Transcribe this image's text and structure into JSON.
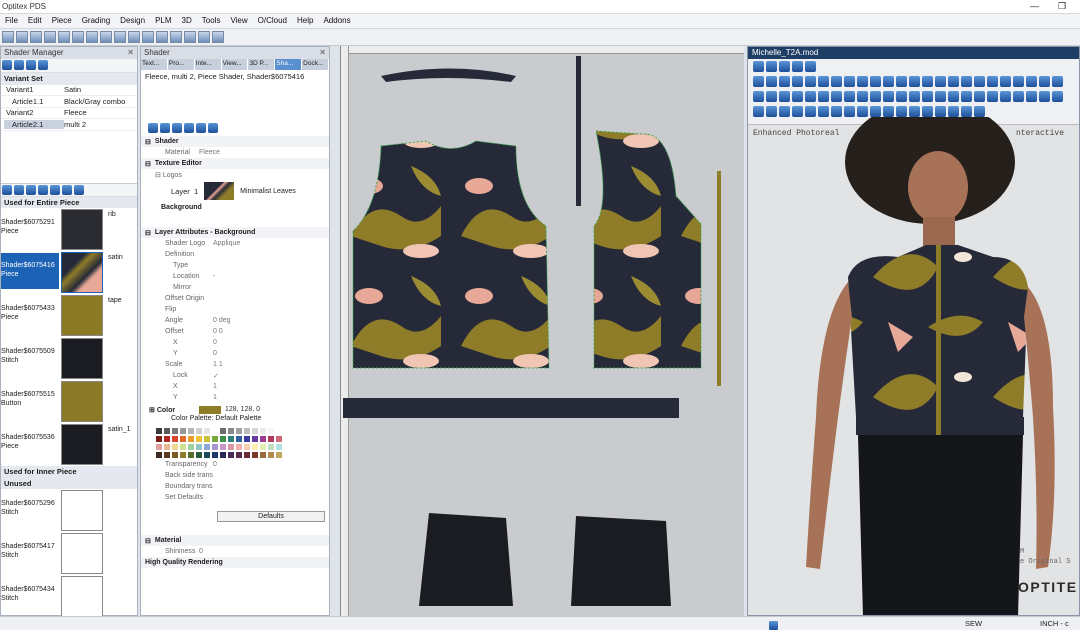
{
  "app": {
    "title": "Optitex PDS",
    "menus": [
      "File",
      "Edit",
      "Piece",
      "Grading",
      "Design",
      "PLM",
      "3D",
      "Tools",
      "View",
      "O/Cloud",
      "Help",
      "Addons"
    ]
  },
  "shader_manager": {
    "title": "Shader Manager",
    "variant_header": "Variant Set",
    "variants": [
      {
        "name": "Variant1",
        "value": "Satin"
      },
      {
        "name": "Article1.1",
        "value": "Black/Gray combo"
      },
      {
        "name": "Variant2",
        "value": "Fleece"
      },
      {
        "name": "Article2.1",
        "value": "multi 2"
      }
    ],
    "used_entire_header": "Used for Entire Piece",
    "shaders_entire": [
      {
        "name": "Shader$6075291\nPiece",
        "tag": "rib",
        "color": "#2b2c31"
      },
      {
        "name": "Shader$6075416\nPiece",
        "tag": "satin",
        "color": "#8f7c28"
      },
      {
        "name": "Shader$6075433\nPiece",
        "tag": "tape",
        "color": "#8b7a25"
      },
      {
        "name": "Shader$6075509\nStitch",
        "tag": "",
        "color": "#1b1c22"
      },
      {
        "name": "Shader$6075515\nButton",
        "tag": "",
        "color": "#8a7a27"
      },
      {
        "name": "Shader$6075536\nPiece",
        "tag": "satin_1",
        "color": "#1c1d23"
      }
    ],
    "used_inner_header": "Used for Inner Piece",
    "unused_header": "Unused",
    "shaders_unused": [
      {
        "name": "Shader$6075296\nStitch",
        "tag": "",
        "color": "#ffffff"
      },
      {
        "name": "Shader$6075417\nStitch",
        "tag": "",
        "color": "#ffffff"
      },
      {
        "name": "Shader$6075434\nStitch",
        "tag": "",
        "color": "#ffffff"
      }
    ]
  },
  "shader_panel": {
    "title": "Shader",
    "tabs": [
      "Text...",
      "Pro...",
      "Inte...",
      "View...",
      "3D P...",
      "Sha...",
      "Dock..."
    ],
    "breadcrumb": "Fleece, multi 2, Piece Shader, Shader$6075416",
    "section_shader": "Shader",
    "material_label": "Material",
    "material_value": "Fleece",
    "texture_editor": "Texture Editor",
    "logos": "Logos",
    "layer_label": "Layer",
    "layer_index": "1",
    "layer_name": "Minimalist Leaves",
    "background": "Background",
    "layer_attrs": "Layer Attributes - Background",
    "props": [
      {
        "k": "Shader Logo",
        "v": "Applique"
      },
      {
        "k": "Definition",
        "v": ""
      },
      {
        "k": "Type",
        "v": ""
      },
      {
        "k": "Location",
        "v": "-"
      },
      {
        "k": "Mirror",
        "v": ""
      },
      {
        "k": "Offset Origin",
        "v": ""
      },
      {
        "k": "Flip",
        "v": ""
      },
      {
        "k": "Angle",
        "v": "0 deg"
      },
      {
        "k": "Offset",
        "v": "0  0"
      },
      {
        "k": "X",
        "v": "0"
      },
      {
        "k": "Y",
        "v": "0"
      },
      {
        "k": "Scale",
        "v": "1  1"
      },
      {
        "k": "Lock",
        "v": "✓"
      },
      {
        "k": "X",
        "v": "1"
      },
      {
        "k": "Y",
        "v": "1"
      }
    ],
    "color_label": "Color",
    "color_value": "128, 128, 0",
    "palette_label": "Color Palette: Default Palette",
    "props2": [
      {
        "k": "Transparency",
        "v": "0"
      },
      {
        "k": "Back side trans",
        "v": ""
      },
      {
        "k": "Boundary trans",
        "v": ""
      },
      {
        "k": "Set Defaults",
        "v": ""
      }
    ],
    "defaults_btn": "Defaults",
    "material_section": "Material",
    "shininess_label": "Shininess",
    "shininess_value": "0",
    "hq_render": "High Quality Rendering"
  },
  "viewer": {
    "title": "Michelle_T2A.mod",
    "overlay_left": "Enhanced Photoreal",
    "overlay_right": "nteractive",
    "brand": "OPTITE",
    "watermark": "M\ne Original S"
  },
  "status": {
    "sew": "SEW",
    "units": "INCH - c"
  },
  "colors": {
    "olive": "#8f7c28",
    "navy": "#262a38",
    "pink": "#e8a898",
    "selection": "#1c62b5"
  }
}
